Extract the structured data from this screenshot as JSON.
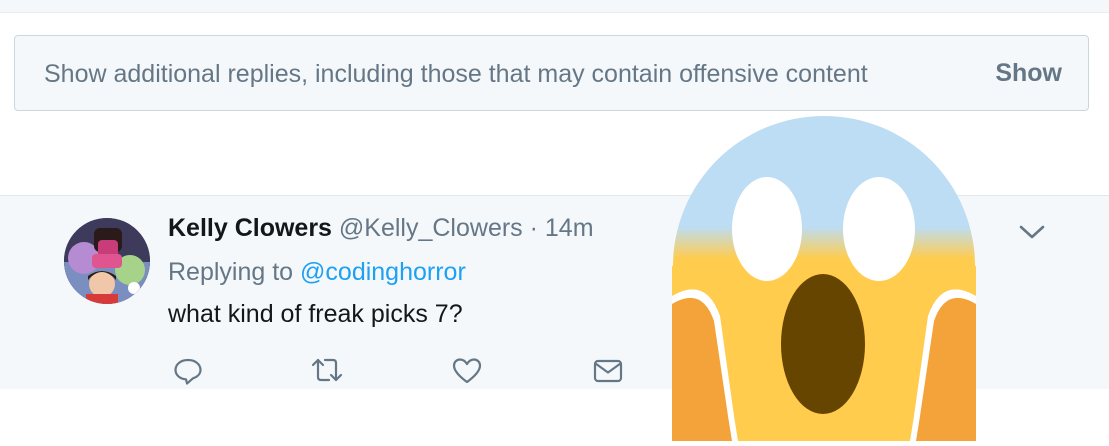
{
  "show_more": {
    "text": "Show additional replies, including those that may contain offensive content",
    "button_label": "Show"
  },
  "tweet": {
    "author_name": "Kelly Clowers",
    "author_handle": "@Kelly_Clowers",
    "separator": "·",
    "time": "14m",
    "replying_prefix": "Replying to",
    "replying_to": "@codinghorror",
    "text": "what kind of freak picks 7?",
    "actions": [
      "reply-icon",
      "retweet-icon",
      "like-icon",
      "direct-message-icon"
    ],
    "menu_icon": "chevron-down-icon"
  },
  "overlay": {
    "emoji": "face-screaming-in-fear-emoji"
  },
  "colors": {
    "background": "#f5f8fa",
    "secondary_text": "#657786",
    "link": "#1da1f2",
    "primary_text": "#14171a",
    "emoji_yellow": "#ffcc4d",
    "emoji_blue": "#bdddf4",
    "emoji_hands": "#f4a23a",
    "emoji_mouth": "#664500"
  }
}
